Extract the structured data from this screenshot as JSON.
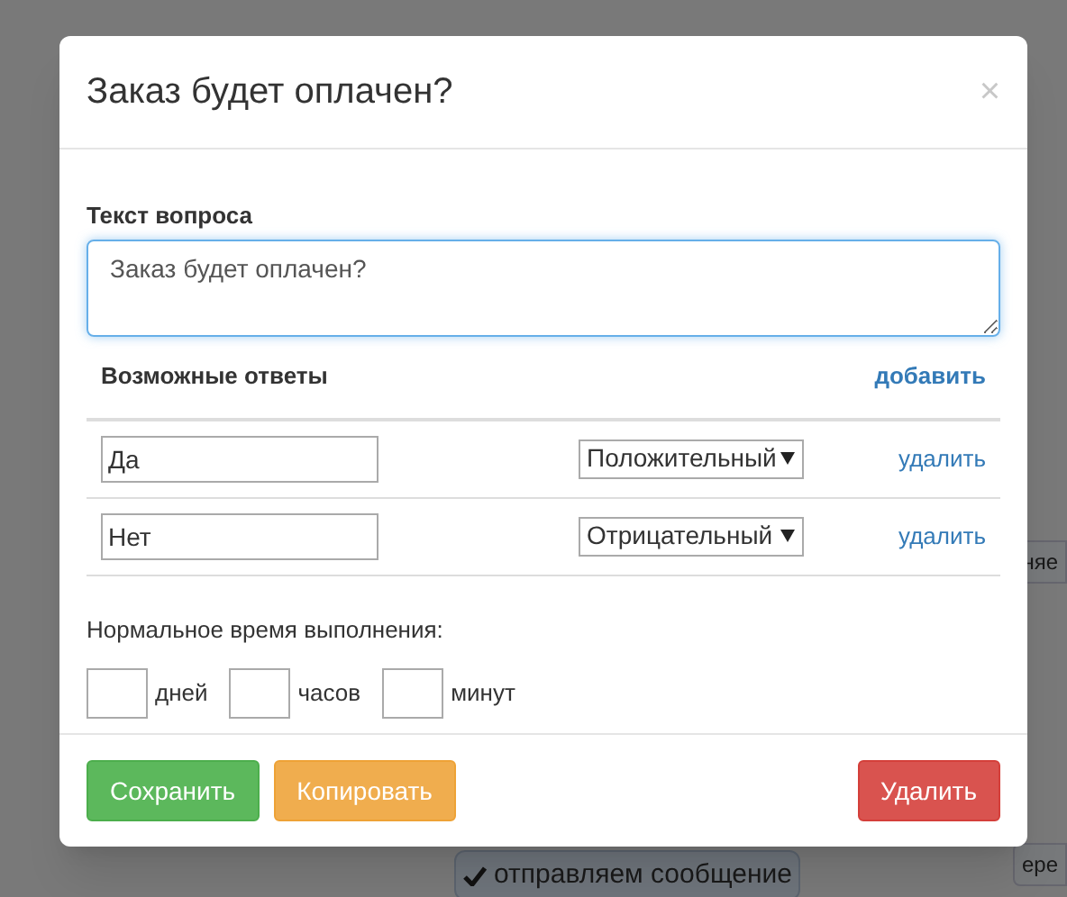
{
  "background_nodes": [
    {
      "text": "няе",
      "kind": "plain"
    },
    {
      "text": "отправляем сообщение",
      "kind": "check"
    },
    {
      "text": "ере",
      "kind": "plain"
    }
  ],
  "dialog": {
    "title": "Заказ будет оплачен?",
    "close": "×",
    "question_label": "Текст вопроса",
    "question": "Заказ будет оплачен?",
    "answers_heading": "Возможные ответы",
    "add_link": "добавить",
    "answers": [
      {
        "value": "Да",
        "type": "Положительный",
        "delete": "удалить"
      },
      {
        "value": "Нет",
        "type": "Отрицательный",
        "delete": "удалить"
      }
    ],
    "duration_label": "Нормальное время выполнения:",
    "duration_units": [
      "дней",
      "часов",
      "минут"
    ],
    "buttons": [
      {
        "label": "Сохранить",
        "kind": "success"
      },
      {
        "label": "Копировать",
        "kind": "warning"
      },
      {
        "label": "Удалить",
        "kind": "danger"
      }
    ]
  }
}
